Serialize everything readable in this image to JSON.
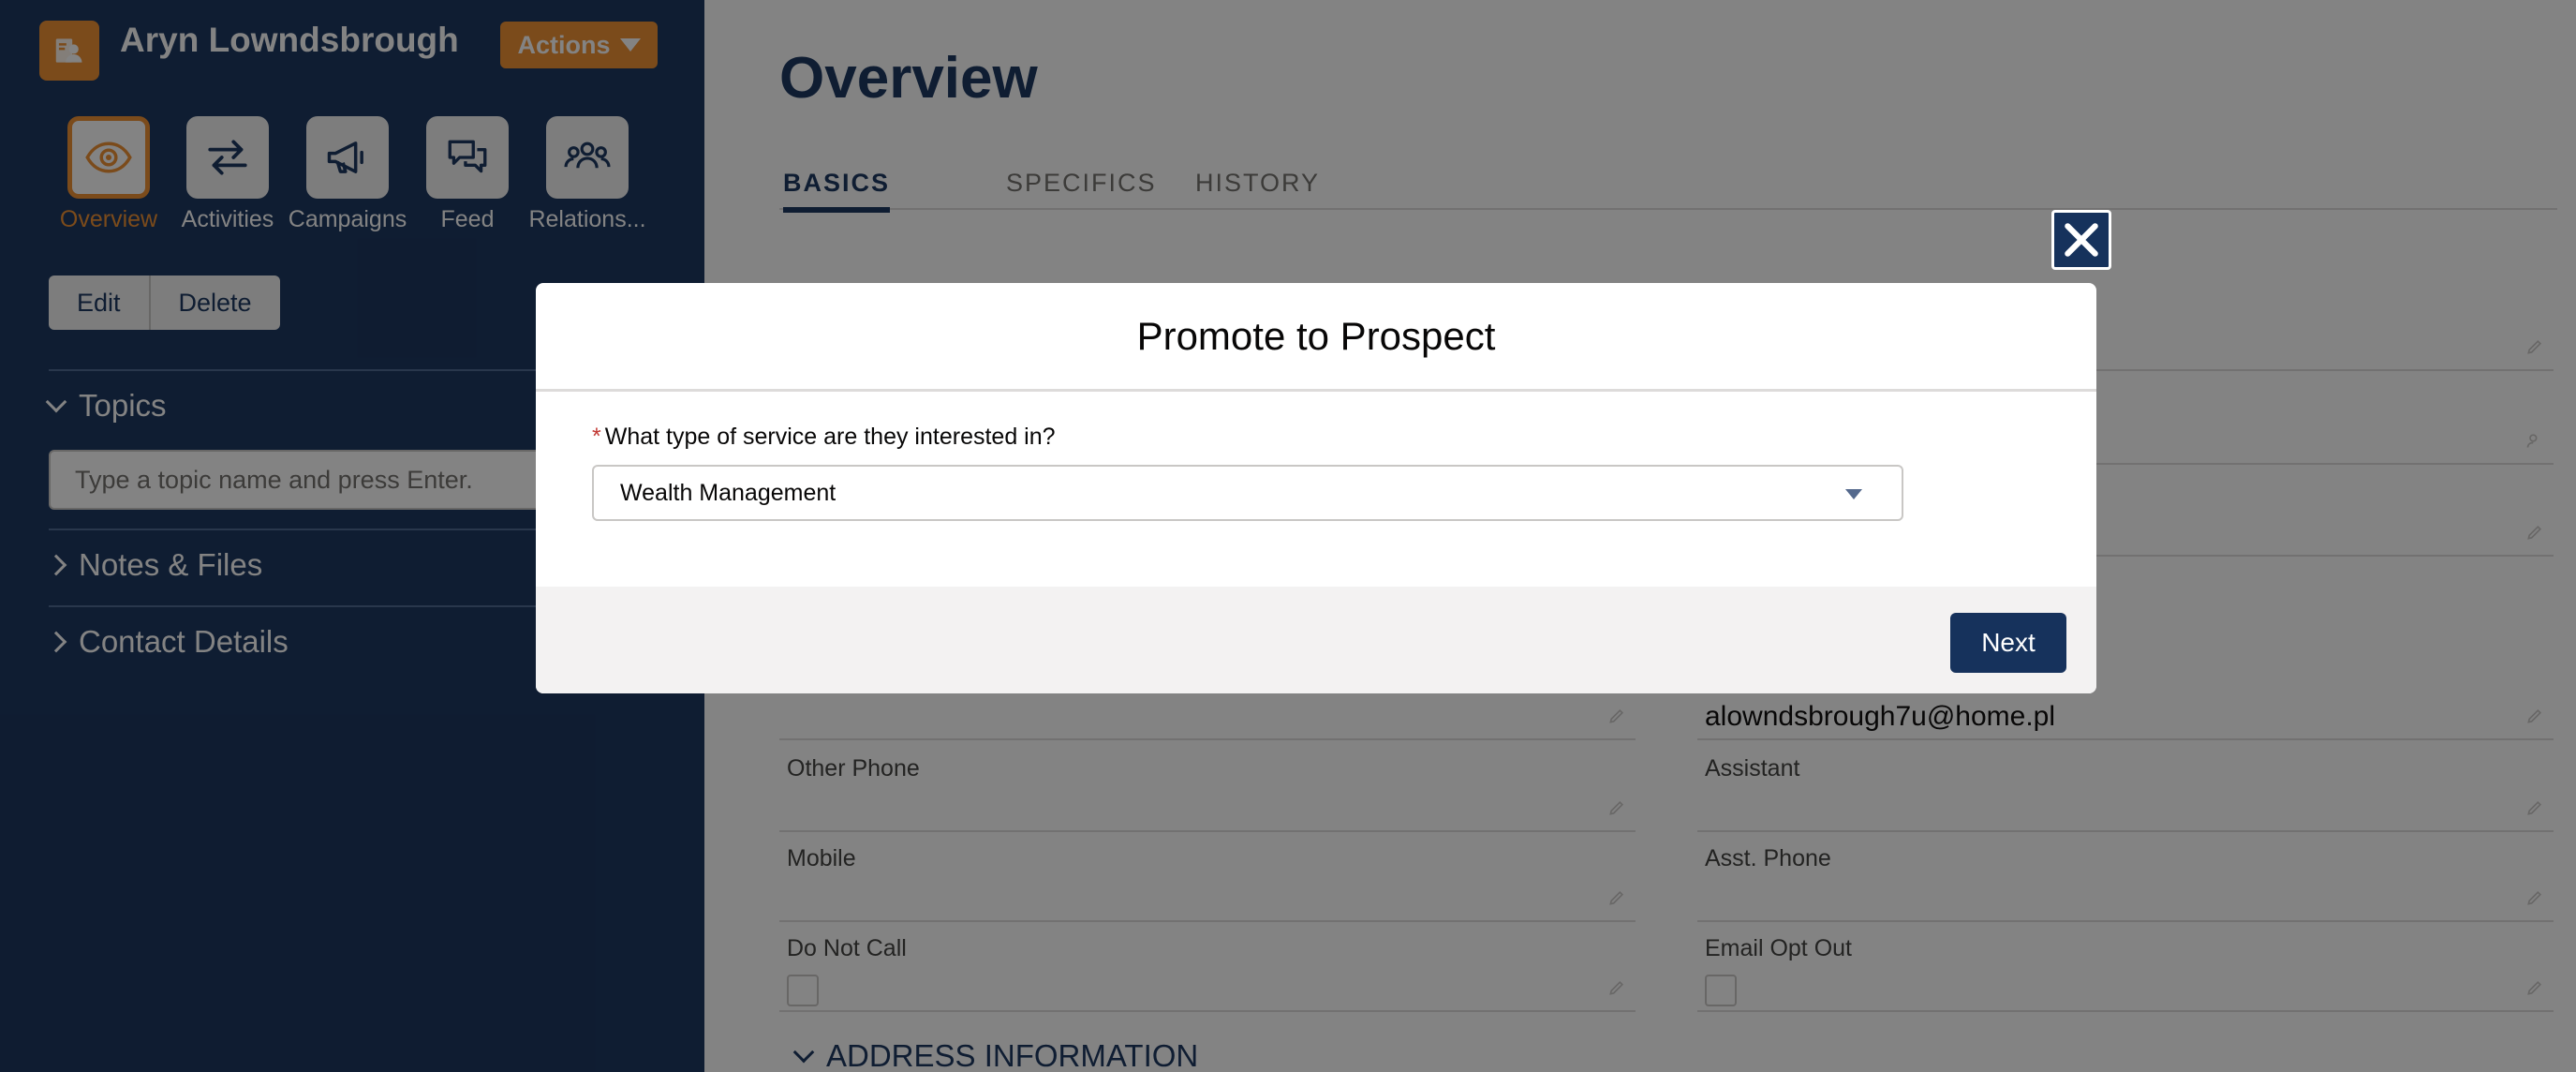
{
  "record": {
    "name": "Aryn Lowndsbrough",
    "actions_label": "Actions"
  },
  "nav": [
    {
      "label": "Overview",
      "icon": "eye-icon"
    },
    {
      "label": "Activities",
      "icon": "arrows-swap-icon"
    },
    {
      "label": "Campaigns",
      "icon": "megaphone-icon"
    },
    {
      "label": "Feed",
      "icon": "chat-bubbles-icon"
    },
    {
      "label": "Relations...",
      "icon": "people-icon"
    }
  ],
  "record_buttons": {
    "edit": "Edit",
    "delete": "Delete"
  },
  "sections": {
    "topics": "Topics",
    "topic_placeholder": "Type a topic name and press Enter.",
    "notes_files": "Notes & Files",
    "contact_details": "Contact Details"
  },
  "main": {
    "title": "Overview",
    "tabs": [
      "BASICS",
      "SPECIFICS",
      "HISTORY"
    ],
    "email_value": "alowndsbrough7u@home.pl",
    "fields": {
      "other_phone": "Other Phone",
      "assistant": "Assistant",
      "mobile": "Mobile",
      "asst_phone": "Asst. Phone",
      "do_not_call": "Do Not Call",
      "email_opt_out": "Email Opt Out"
    },
    "address_section": "ADDRESS INFORMATION"
  },
  "modal": {
    "title": "Promote to Prospect",
    "question": "What type of service are they interested in?",
    "selected_value": "Wealth Management",
    "next_label": "Next"
  },
  "colors": {
    "sidebar_bg": "#16325c",
    "accent": "#ef8e2f",
    "brand": "#16325c",
    "required": "#c23934"
  }
}
